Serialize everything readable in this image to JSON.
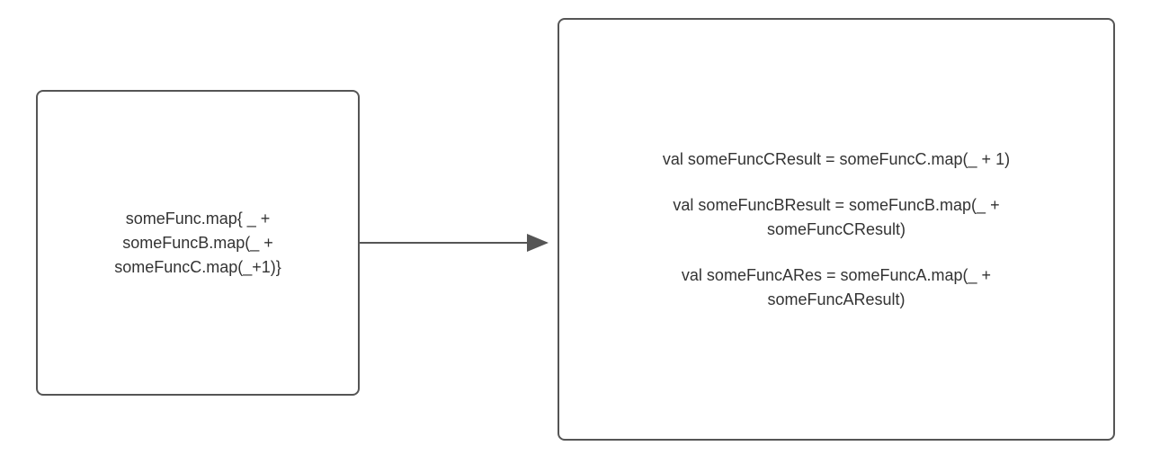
{
  "leftBox": {
    "line1": "someFunc.map{ _ +",
    "line2": "someFuncB.map(_ +",
    "line3": "someFuncC.map(_+1)}"
  },
  "rightBox": {
    "block1": "val someFuncCResult = someFuncC.map(_ + 1)",
    "block2_line1": "val someFuncBResult = someFuncB.map(_ +",
    "block2_line2": "someFuncCResult)",
    "block3_line1": "val someFuncARes = someFuncA.map(_ +",
    "block3_line2": "someFuncAResult)"
  },
  "colors": {
    "border": "#555555",
    "text": "#333333"
  }
}
